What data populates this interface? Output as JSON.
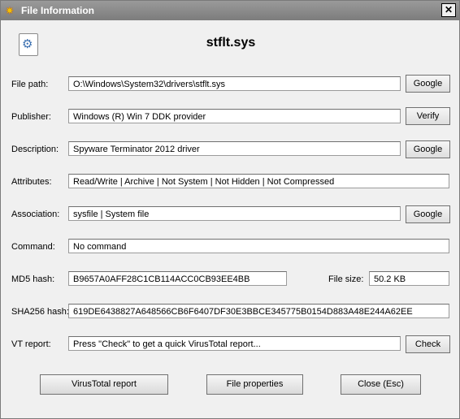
{
  "window": {
    "title": "File Information",
    "close_glyph": "✕"
  },
  "file_name": "stflt.sys",
  "rows": {
    "file_path": {
      "label": "File path:",
      "value": "O:\\Windows\\System32\\drivers\\stflt.sys",
      "button": "Google"
    },
    "publisher": {
      "label": "Publisher:",
      "value": "Windows (R) Win 7 DDK provider",
      "button": "Verify"
    },
    "description": {
      "label": "Description:",
      "value": "Spyware Terminator 2012 driver",
      "button": "Google"
    },
    "attributes": {
      "label": "Attributes:",
      "value": "Read/Write | Archive | Not System | Not Hidden | Not Compressed"
    },
    "association": {
      "label": "Association:",
      "value": "sysfile | System file",
      "button": "Google"
    },
    "command": {
      "label": "Command:",
      "value": "No command"
    },
    "md5": {
      "label": "MD5 hash:",
      "value": "B9657A0AFF28C1CB114ACC0CB93EE4BB"
    },
    "file_size": {
      "label": "File size:",
      "value": "50.2 KB"
    },
    "sha256": {
      "label": "SHA256 hash:",
      "value": "619DE6438827A648566CB6F6407DF30E3BBCE345775B0154D883A48E244A62EE"
    },
    "vt_report": {
      "label": "VT report:",
      "value": "Press \"Check\" to get a quick VirusTotal report...",
      "button": "Check"
    }
  },
  "footer": {
    "virustotal_report": "VirusTotal report",
    "file_properties": "File properties",
    "close": "Close (Esc)"
  },
  "icons": {
    "title": "app-logo-icon",
    "file": "system-file-gear-icon"
  }
}
